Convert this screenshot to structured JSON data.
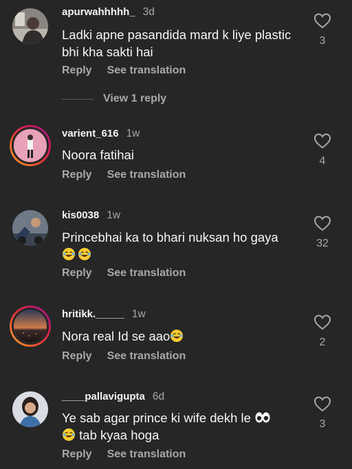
{
  "comments": [
    {
      "username": "apurwahhhhh_",
      "time": "3d",
      "text": "Ladki apne pasandida mard k liye plastic bhi kha sakti hai",
      "likes": "3",
      "reply_label": "Reply",
      "translate_label": "See translation",
      "view_replies": "View 1 reply"
    },
    {
      "username": "varient_616",
      "time": "1w",
      "text": "Noora fatihai",
      "likes": "4",
      "reply_label": "Reply",
      "translate_label": "See translation"
    },
    {
      "username": "kis0038",
      "time": "1w",
      "text": "Princebhai ka to bhari nuksan ho gaya",
      "likes": "32",
      "reply_label": "Reply",
      "translate_label": "See translation"
    },
    {
      "username": "hritikk._____",
      "time": "1w",
      "text": "Nora real Id se aao",
      "likes": "2",
      "reply_label": "Reply",
      "translate_label": "See translation"
    },
    {
      "username": "____pallavigupta",
      "time": "6d",
      "text_line1": "Ye sab agar prince ki wife dekh le",
      "text_line2": "tab kyaa hoga",
      "likes": "3",
      "reply_label": "Reply",
      "translate_label": "See translation"
    }
  ],
  "colors": {
    "background": "#262626",
    "primary_text": "#f5f5f5",
    "secondary_text": "#a8a8a8",
    "story_ring": "#e53935"
  },
  "icons": {
    "like": "heart-outline-icon",
    "laugh": "face-with-tears-of-joy-emoji",
    "eyes": "eyes-emoji"
  }
}
